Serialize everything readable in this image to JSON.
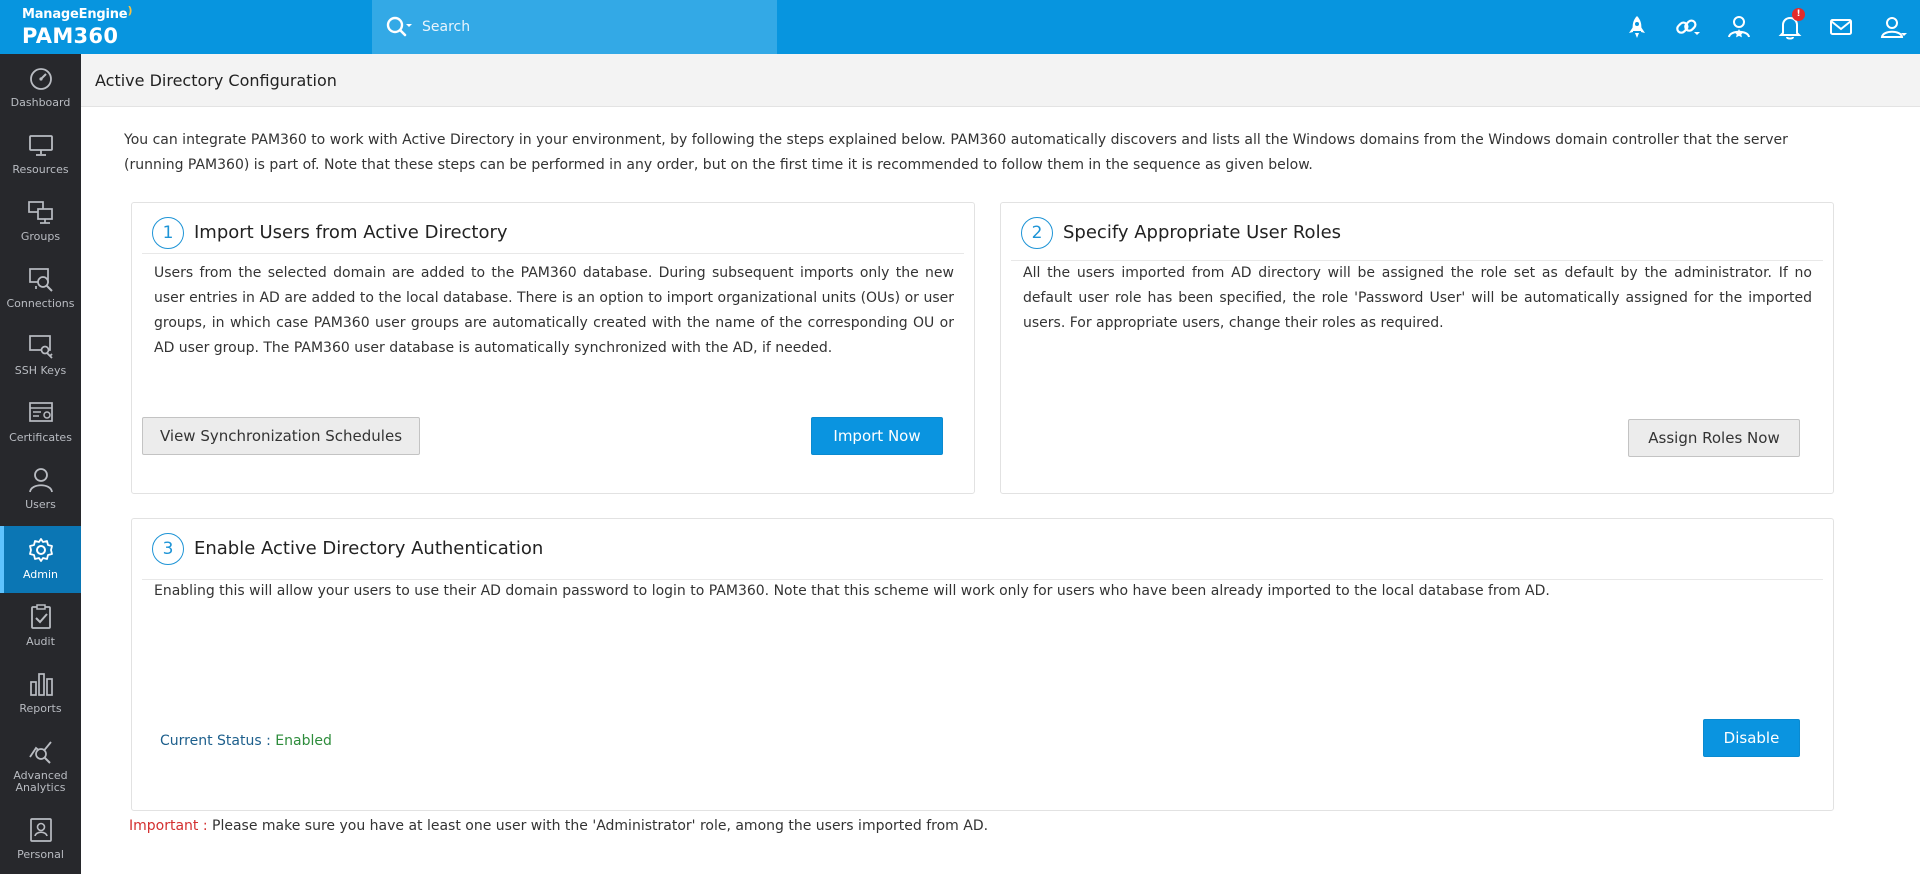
{
  "brand": {
    "company": "ManageEngine",
    "product": "PAM360"
  },
  "search": {
    "placeholder": "Search"
  },
  "top_icons": [
    {
      "name": "rocket-icon"
    },
    {
      "name": "link-icon"
    },
    {
      "name": "user-star-icon"
    },
    {
      "name": "bell-icon",
      "badge": "!"
    },
    {
      "name": "mail-icon"
    },
    {
      "name": "user-icon"
    }
  ],
  "sidebar": {
    "items": [
      {
        "label": "Dashboard",
        "icon": "dashboard-icon"
      },
      {
        "label": "Resources",
        "icon": "monitor-icon"
      },
      {
        "label": "Groups",
        "icon": "groups-icon"
      },
      {
        "label": "Connections",
        "icon": "connections-icon"
      },
      {
        "label": "SSH Keys",
        "icon": "ssh-key-icon"
      },
      {
        "label": "Certificates",
        "icon": "certificate-icon"
      },
      {
        "label": "Users",
        "icon": "users-icon"
      },
      {
        "label": "Admin",
        "icon": "gear-icon",
        "active": true
      },
      {
        "label": "Audit",
        "icon": "audit-icon"
      },
      {
        "label": "Reports",
        "icon": "reports-icon"
      },
      {
        "label": "Advanced",
        "label2": "Analytics",
        "icon": "analytics-icon"
      },
      {
        "label": "Personal",
        "icon": "personal-icon"
      }
    ]
  },
  "page": {
    "title": "Active Directory Configuration",
    "intro": "You can integrate PAM360 to work with Active Directory in your environment, by following the steps explained below. PAM360 automatically discovers and lists all the Windows domains from the Windows domain controller that the server (running PAM360) is part of. Note that these steps can be performed in any order, but on the first time it is recommended to follow them in the sequence as given below."
  },
  "step1": {
    "number": "1",
    "title": "Import Users from Active Directory",
    "description": "Users from the selected domain are added to the PAM360 database. During subsequent imports only the new user entries in AD are added to the local database. There is an option to import organizational units (OUs) or user groups, in which case PAM360 user groups are automatically created with the name of the corresponding OU or AD user group. The PAM360 user database is automatically synchronized with the AD, if needed.",
    "schedule_button": "View Synchronization Schedules",
    "import_button": "Import Now"
  },
  "step2": {
    "number": "2",
    "title": "Specify Appropriate User Roles",
    "description": "All the users imported from AD directory will be assigned the role set as default by the administrator. If no default user role has been specified, the role 'Password User' will be automatically assigned for the imported users. For appropriate users, change their roles as required.",
    "assign_button": "Assign Roles Now"
  },
  "step3": {
    "number": "3",
    "title": "Enable Active Directory Authentication",
    "description": "Enabling this will allow your users to use their AD domain password to login to PAM360. Note that this scheme will work only for users who have been already imported to the local database from AD.",
    "status_label": "Current Status : ",
    "status_value": "Enabled",
    "disable_button": "Disable"
  },
  "important": {
    "label": "Important : ",
    "text": "Please make sure you have at least one user with the 'Administrator' role, among the users imported from AD."
  },
  "colors": {
    "topbar": "#0795df",
    "sidebar": "#27282c",
    "sidebar_active": "#0b76b4",
    "primary_button": "#0a94e0",
    "status_enabled": "#2d8c3b",
    "important": "#d32f2f"
  }
}
